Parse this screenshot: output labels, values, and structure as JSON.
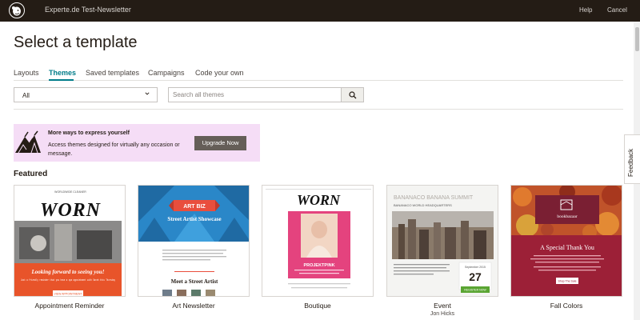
{
  "topbar": {
    "campaign_title": "Experte.de Test-Newsletter",
    "help_label": "Help",
    "cancel_label": "Cancel"
  },
  "page": {
    "title": "Select a template"
  },
  "tabs": [
    {
      "label": "Layouts",
      "active": false
    },
    {
      "label": "Themes",
      "active": true
    },
    {
      "label": "Saved templates",
      "active": false
    },
    {
      "label": "Campaigns",
      "active": false
    },
    {
      "label": "Code your own",
      "active": false
    }
  ],
  "filters": {
    "category_selected": "All",
    "search_placeholder": "Search all themes",
    "search_value": ""
  },
  "promo": {
    "heading": "More ways to express yourself",
    "body": "Access themes designed for virtually any occasion or message.",
    "button_label": "Upgrade Now"
  },
  "section": {
    "featured_label": "Featured"
  },
  "feedback_label": "Feedback",
  "templates": [
    {
      "name": "Appointment Reminder",
      "author": "",
      "preview": {
        "brand": "WORN",
        "small_header": "WORLDWIDE CLEANER",
        "headline": "Looking forward to seeing you!",
        "body": "Just a friendly reminder that you have a spa appointment with Sarah this Thursday",
        "button": "VIEW APPOINTMENT"
      }
    },
    {
      "name": "Art Newsletter",
      "author": "",
      "preview": {
        "ribbon": "ART BIZ",
        "headline": "Street Artist Showcase",
        "subhead": "Meet a Street Artist"
      }
    },
    {
      "name": "Boutique",
      "author": "",
      "preview": {
        "brand": "WORN",
        "banner": "PROJEKTPINK"
      }
    },
    {
      "name": "Event",
      "author": "Jon Hicks",
      "preview": {
        "title": "BANANACO BANANA SUMMIT",
        "subtitle": "BANANACO WORLD HEADQUARTERS",
        "month": "September 2015",
        "day": "27",
        "button": "REGISTER NOW"
      }
    },
    {
      "name": "Fall Colors",
      "author": "",
      "preview": {
        "logo": "bookbazaar",
        "headline": "A Special Thank You",
        "button": "Shop The Sale"
      }
    }
  ],
  "colors": {
    "topbar": "#241c15",
    "accent": "#007c89",
    "promo_bg": "#f5ddf6",
    "upgrade_button": "#655e58"
  }
}
